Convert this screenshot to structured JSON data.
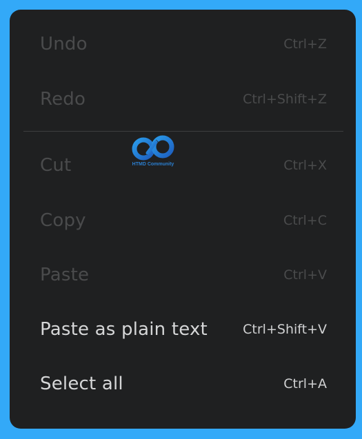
{
  "menu": {
    "items": [
      {
        "label": "Undo",
        "shortcut": "Ctrl+Z",
        "enabled": false
      },
      {
        "label": "Redo",
        "shortcut": "Ctrl+Shift+Z",
        "enabled": false
      },
      {
        "label": "Cut",
        "shortcut": "Ctrl+X",
        "enabled": false
      },
      {
        "label": "Copy",
        "shortcut": "Ctrl+C",
        "enabled": false
      },
      {
        "label": "Paste",
        "shortcut": "Ctrl+V",
        "enabled": false
      },
      {
        "label": "Paste as plain text",
        "shortcut": "Ctrl+Shift+V",
        "enabled": true
      },
      {
        "label": "Select all",
        "shortcut": "Ctrl+A",
        "enabled": true
      }
    ]
  },
  "watermark": {
    "text": "HTMD Community",
    "icon": "htmd-logo-icon"
  },
  "colors": {
    "background": "#33a9f8",
    "menu": "#1f2021",
    "text_enabled": "#d6d7d8",
    "text_disabled": "#4a4b4c",
    "logo": "#2b7fd0"
  }
}
